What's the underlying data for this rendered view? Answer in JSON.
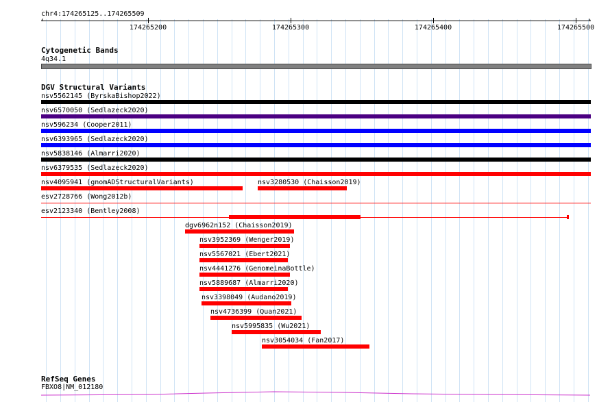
{
  "ruler": {
    "location": "chr4:174265125..174265509",
    "ticks": [
      "174265200",
      "174265300",
      "174265400",
      "174265500"
    ]
  },
  "cytoband": {
    "title": "Cytogenetic Bands",
    "band": "4q34.1",
    "color": "#808080"
  },
  "dgv": {
    "title": "DGV Structural Variants",
    "features": [
      {
        "label": "nsv5562145 (ByrskaBishop2022)",
        "color": "#000000"
      },
      {
        "label": "nsv6570050 (Sedlazeck2020)",
        "color": "#4b0082"
      },
      {
        "label": "nsv596234 (Cooper2011)",
        "color": "#0000ff"
      },
      {
        "label": "nsv6393965 (Sedlazeck2020)",
        "color": "#0000ff"
      },
      {
        "label": "nsv5838146 (Almarri2020)",
        "color": "#000000"
      },
      {
        "label": "nsv6379535 (Sedlazeck2020)",
        "color": "#ff0000"
      },
      {
        "label": "nsv4095941 (gnomADStructuralVariants)",
        "color": "#ff0000"
      },
      {
        "label": "nsv3280530 (Chaisson2019)",
        "color": "#ff0000"
      },
      {
        "label": "esv2728766 (Wong2012b)",
        "color": "#ff0000"
      },
      {
        "label": "esv2123340 (Bentley2008)",
        "color": "#ff0000"
      },
      {
        "label": "dgv6962n152 (Chaisson2019)",
        "color": "#ff0000"
      },
      {
        "label": "nsv3952369 (Wenger2019)",
        "color": "#ff0000"
      },
      {
        "label": "nsv5567021 (Ebert2021)",
        "color": "#ff0000"
      },
      {
        "label": "nsv4441276 (GenomeinaBottle)",
        "color": "#ff0000"
      },
      {
        "label": "nsv5889687 (Almarri2020)",
        "color": "#ff0000"
      },
      {
        "label": "nsv3398049 (Audano2019)",
        "color": "#ff0000"
      },
      {
        "label": "nsv4736399 (Quan2021)",
        "color": "#ff0000"
      },
      {
        "label": "nsv5995835 (Wu2021)",
        "color": "#ff0000"
      },
      {
        "label": "nsv3054034 (Fan2017)",
        "color": "#ff0000"
      }
    ]
  },
  "refseq": {
    "title": "RefSeq Genes",
    "gene": "FBXO8|NM_012180",
    "color": "#cc33cc"
  }
}
